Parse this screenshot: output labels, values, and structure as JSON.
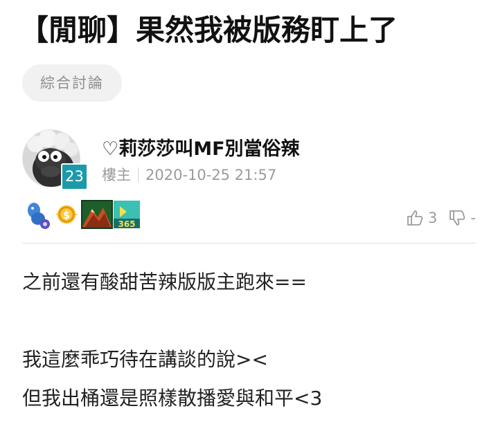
{
  "post": {
    "title": "【閒聊】果然我被版務盯上了",
    "board_tag": "綜合討論",
    "author": {
      "name": "♡莉莎莎叫MF別當俗辣",
      "level": "23",
      "role": "樓主",
      "timestamp": "2020-10-25 21:57"
    },
    "medals": [
      "blue-character-medal",
      "gold-coin-medal",
      "mountain-medal",
      "365-medal"
    ],
    "reactions": {
      "like_count": "3",
      "dislike_count": "-"
    },
    "body_lines": [
      "之前還有酸甜苦辣版版主跑來==",
      "",
      "我這麼乖巧待在講談的說><",
      "但我出桶還是照樣散播愛與和平<3"
    ]
  },
  "colors": {
    "level_badge": "#1b9aaa",
    "tag_bg": "#f1f1f1",
    "meta_text": "#9b9b9b"
  }
}
